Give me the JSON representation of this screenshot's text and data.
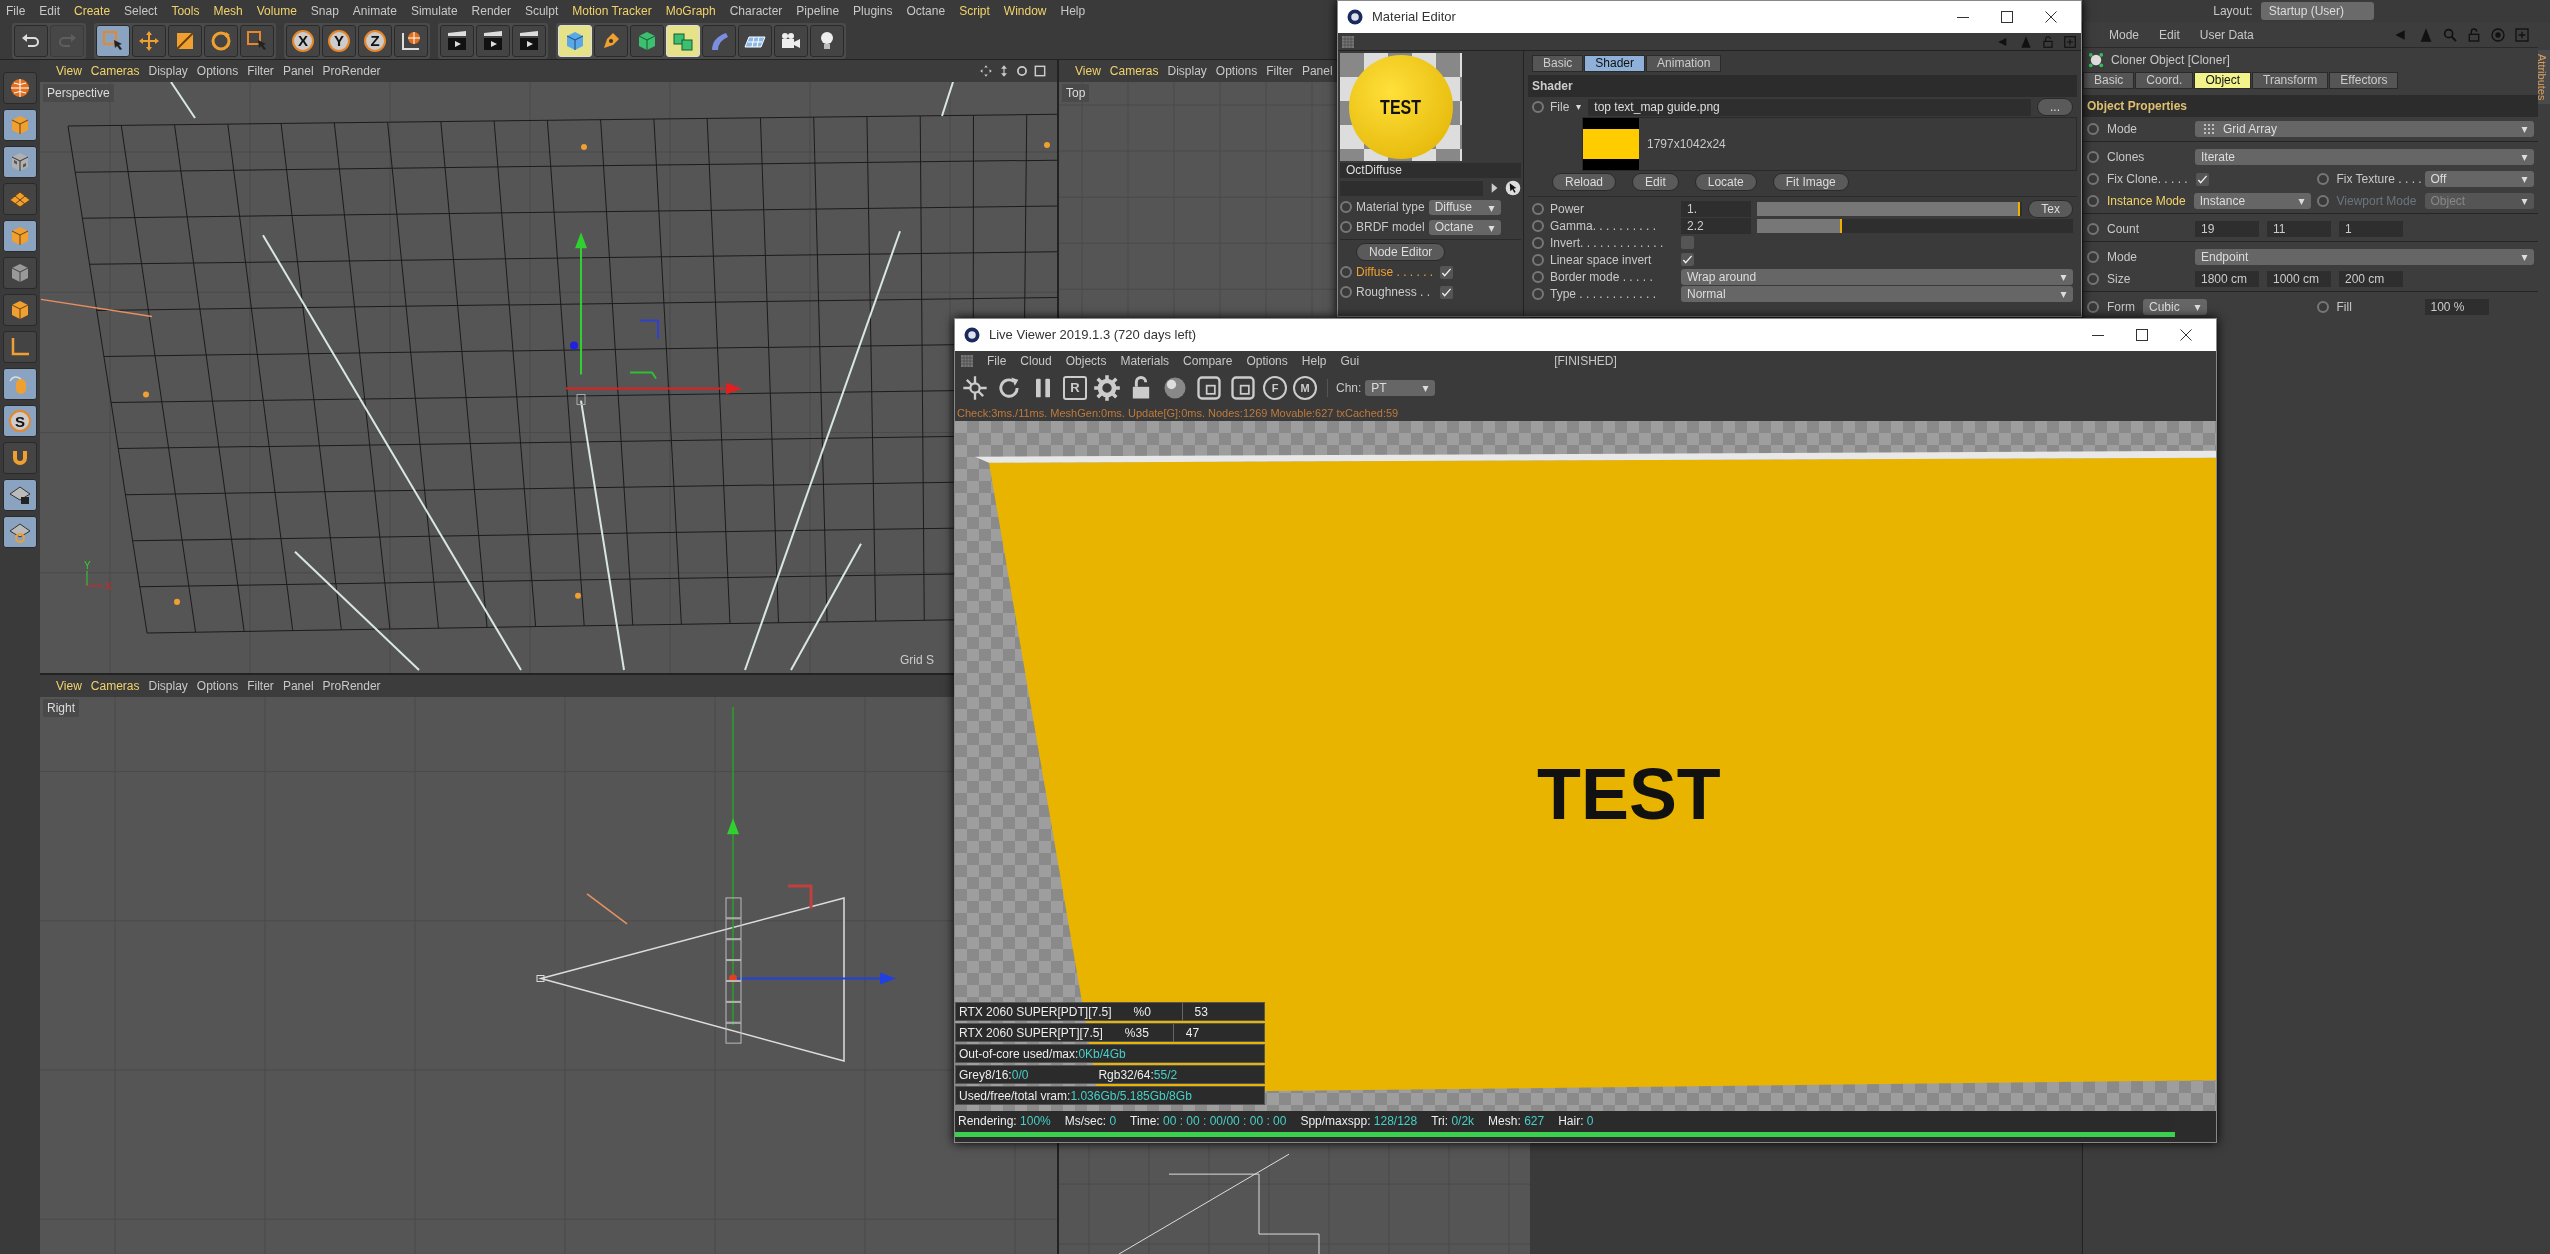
{
  "menu_bar": [
    {
      "label": "File",
      "highlighted": false
    },
    {
      "label": "Edit",
      "highlighted": false
    },
    {
      "label": "Create",
      "highlighted": true
    },
    {
      "label": "Select",
      "highlighted": false
    },
    {
      "label": "Tools",
      "highlighted": true
    },
    {
      "label": "Mesh",
      "highlighted": true
    },
    {
      "label": "Volume",
      "highlighted": true
    },
    {
      "label": "Snap",
      "highlighted": false
    },
    {
      "label": "Animate",
      "highlighted": false
    },
    {
      "label": "Simulate",
      "highlighted": false
    },
    {
      "label": "Render",
      "highlighted": false
    },
    {
      "label": "Sculpt",
      "highlighted": false
    },
    {
      "label": "Motion Tracker",
      "highlighted": true
    },
    {
      "label": "MoGraph",
      "highlighted": true
    },
    {
      "label": "Character",
      "highlighted": false
    },
    {
      "label": "Pipeline",
      "highlighted": false
    },
    {
      "label": "Plugins",
      "highlighted": false
    },
    {
      "label": "Octane",
      "highlighted": false
    },
    {
      "label": "Script",
      "highlighted": true
    },
    {
      "label": "Window",
      "highlighted": true
    },
    {
      "label": "Help",
      "highlighted": false
    }
  ],
  "layout": {
    "label": "Layout:",
    "value": "Startup (User)"
  },
  "toolbar": [
    [
      {
        "kind": "undo",
        "active": false,
        "disabled": false
      },
      {
        "kind": "redo",
        "active": false,
        "disabled": true
      }
    ],
    [
      {
        "kind": "select",
        "active": true
      },
      {
        "kind": "move",
        "active": false
      },
      {
        "kind": "scale",
        "active": false
      },
      {
        "kind": "rotate",
        "active": false
      },
      {
        "kind": "select",
        "active": false
      }
    ],
    [
      {
        "kind": "axis-lock",
        "text": "X",
        "active": false
      },
      {
        "kind": "axis-lock",
        "text": "Y",
        "active": false
      },
      {
        "kind": "axis-lock",
        "text": "Z",
        "active": false
      },
      {
        "kind": "world",
        "active": false
      }
    ],
    [
      {
        "kind": "clapper",
        "active": false
      },
      {
        "kind": "clapper",
        "active": false
      },
      {
        "kind": "clapper",
        "active": false
      }
    ],
    [
      {
        "kind": "cube",
        "active": true
      },
      {
        "kind": "pen",
        "active": false
      },
      {
        "kind": "gcube",
        "active": false
      },
      {
        "kind": "cubes",
        "active": true
      },
      {
        "kind": "bend",
        "active": false
      },
      {
        "kind": "plane",
        "active": false
      },
      {
        "kind": "camera",
        "active": false
      },
      {
        "kind": "bulb",
        "active": false
      }
    ]
  ],
  "side_tools": [
    {
      "kind": "globe",
      "active": false
    },
    {
      "kind": "ocube",
      "active": true
    },
    {
      "kind": "checker",
      "active": true
    },
    {
      "kind": "grid",
      "active": false
    },
    {
      "kind": "ocube",
      "active": true
    },
    {
      "kind": "gcube2",
      "active": false
    },
    {
      "kind": "ocube",
      "active": false
    },
    {
      "kind": "axis",
      "active": false
    },
    {
      "kind": "mouse",
      "active": true
    },
    {
      "kind": "snap",
      "text": "S",
      "active": true
    },
    {
      "kind": "magnet",
      "active": false
    },
    {
      "kind": "gridlock",
      "active": true
    },
    {
      "kind": "gridrot",
      "active": true
    }
  ],
  "viewports": [
    {
      "name": "Perspective",
      "kind": "perspective",
      "grid_label": "Grid S",
      "axis_labels": [
        "Y",
        "X"
      ],
      "menu": [
        {
          "label": "View",
          "highlighted": true
        },
        {
          "label": "Cameras",
          "highlighted": true
        },
        {
          "label": "Display",
          "highlighted": false
        },
        {
          "label": "Options",
          "highlighted": false
        },
        {
          "label": "Filter",
          "highlighted": false
        },
        {
          "label": "Panel",
          "highlighted": false
        },
        {
          "label": "ProRender",
          "highlighted": false
        }
      ]
    },
    {
      "name": "Top",
      "kind": "top",
      "menu": [
        {
          "label": "View",
          "highlighted": true
        },
        {
          "label": "Cameras",
          "highlighted": true
        },
        {
          "label": "Display",
          "highlighted": false
        },
        {
          "label": "Options",
          "highlighted": false
        },
        {
          "label": "Filter",
          "highlighted": false
        },
        {
          "label": "Panel",
          "highlighted": false
        }
      ]
    },
    {
      "name": "Right",
      "kind": "right",
      "menu": [
        {
          "label": "View",
          "highlighted": true
        },
        {
          "label": "Cameras",
          "highlighted": true
        },
        {
          "label": "Display",
          "highlighted": false
        },
        {
          "label": "Options",
          "highlighted": false
        },
        {
          "label": "Filter",
          "highlighted": false
        },
        {
          "label": "Panel",
          "highlighted": false
        },
        {
          "label": "ProRender",
          "highlighted": false
        }
      ]
    },
    {
      "kind": "front"
    }
  ],
  "material_editor": {
    "title": "Material Editor",
    "preview_text": "TEST",
    "material_name": "OctDiffuse",
    "left_params": [
      {
        "label": "Material type",
        "value": "Diffuse"
      },
      {
        "label": "BRDF model",
        "value": "Octane"
      }
    ],
    "node_editor": "Node Editor",
    "channels": [
      {
        "label": "Diffuse . . . . . .",
        "checked": true,
        "selected": true
      },
      {
        "label": "Roughness . .",
        "checked": true,
        "selected": false
      }
    ],
    "tabs": [
      {
        "label": "Basic",
        "selected": false
      },
      {
        "label": "Shader",
        "selected": true
      },
      {
        "label": "Animation",
        "selected": false
      }
    ],
    "section": "Shader",
    "file": {
      "label": "File",
      "value": "top text_map guide.png",
      "browse": "..."
    },
    "image_info": "1797x1042x24",
    "buttons": [
      "Reload",
      "Edit",
      "Locate",
      "Fit Image"
    ],
    "params": [
      {
        "kind": "slider",
        "label": "Power",
        "value": "1.",
        "level": 0.99,
        "button": "Tex"
      },
      {
        "kind": "slider",
        "label": "Gamma. . . . . . . . . .",
        "value": "2.2",
        "level": 0.27
      },
      {
        "kind": "check",
        "label": "Invert. . . . . . . . . . . . .",
        "checked": false
      },
      {
        "kind": "check",
        "label": "Linear space invert",
        "checked": true
      },
      {
        "kind": "dropdown",
        "label": "Border mode . . . . .",
        "value": "Wrap around"
      },
      {
        "kind": "dropdown",
        "label": "Type . . . . . . . . . . . .",
        "value": "Normal"
      }
    ]
  },
  "attributes": {
    "menu": [
      "Mode",
      "Edit",
      "User Data"
    ],
    "title": "Cloner Object [Cloner]",
    "side_tab": "Attributes",
    "tabs": [
      {
        "label": "Basic",
        "selected": false
      },
      {
        "label": "Coord.",
        "selected": false
      },
      {
        "label": "Object",
        "selected": true
      },
      {
        "label": "Transform",
        "selected": false
      },
      {
        "label": "Effectors",
        "selected": false
      }
    ],
    "section": "Object Properties",
    "rows": [
      {
        "divider": false,
        "fields": [
          {
            "kind": "icon-dropdown",
            "label": "Mode",
            "value": "Grid Array",
            "highlighted": false,
            "disabled": false
          }
        ]
      },
      {
        "divider": true,
        "fields": [
          {
            "kind": "dropdown",
            "label": "Clones",
            "value": "Iterate",
            "highlighted": false,
            "disabled": false
          }
        ]
      },
      {
        "divider": false,
        "fields": [
          {
            "kind": "check",
            "label": "Fix Clone. . . . .",
            "checked": true,
            "highlighted": false,
            "disabled": false
          },
          {
            "kind": "dropdown",
            "label": "Fix Texture . . . .",
            "value": "Off",
            "highlighted": false,
            "disabled": false
          }
        ]
      },
      {
        "divider": false,
        "fields": [
          {
            "kind": "dropdown",
            "label": "Instance Mode",
            "value": "Instance",
            "highlighted": true,
            "disabled": false
          },
          {
            "kind": "dropdown",
            "label": "Viewport Mode",
            "value": "Object",
            "highlighted": false,
            "disabled": true
          }
        ]
      },
      {
        "divider": true,
        "fields": [
          {
            "kind": "vector",
            "label": "Count",
            "values": [
              "19",
              "11",
              "1"
            ],
            "highlighted": false,
            "disabled": false
          }
        ]
      },
      {
        "divider": true,
        "fields": [
          {
            "kind": "dropdown",
            "label": "Mode",
            "value": "Endpoint",
            "highlighted": false,
            "disabled": false
          }
        ]
      },
      {
        "divider": false,
        "fields": [
          {
            "kind": "vector",
            "label": "Size",
            "values": [
              "1800 cm",
              "1000 cm",
              "200 cm"
            ],
            "highlighted": false,
            "disabled": false
          }
        ]
      },
      {
        "divider": true,
        "fields": [
          {
            "kind": "short-dropdown",
            "label": "Form",
            "value": "Cubic",
            "highlighted": false,
            "disabled": false
          },
          {
            "kind": "number",
            "label": "Fill",
            "value": "100 %",
            "highlighted": false,
            "disabled": false
          }
        ]
      }
    ]
  },
  "live_viewer": {
    "title": "Live Viewer 2019.1.3 (720 days left)",
    "menu": [
      "File",
      "Cloud",
      "Objects",
      "Materials",
      "Compare",
      "Options",
      "Help",
      "Gui"
    ],
    "status": "[FINISHED]",
    "tools": [
      {
        "kind": "burst"
      },
      {
        "kind": "refresh"
      },
      {
        "kind": "pause"
      },
      {
        "kind": "letter-box",
        "text": "R"
      },
      {
        "kind": "gear"
      },
      {
        "kind": "lock"
      },
      {
        "kind": "sphere"
      },
      {
        "kind": "region"
      },
      {
        "kind": "region"
      },
      {
        "kind": "pin",
        "text": "F"
      },
      {
        "kind": "pin",
        "text": "M"
      }
    ],
    "channel": {
      "label": "Chn:",
      "value": "PT"
    },
    "stats_line": "Check:3ms./11ms. MeshGen:0ms. Update[G]:0ms. Nodes:1269 Movable:627 txCached:59",
    "render_text": "TEST",
    "gpus": [
      {
        "name": "RTX 2060 SUPER[PDT][7.5]",
        "usage": "%0",
        "value": "53"
      },
      {
        "name": "RTX 2060 SUPER[PT][7.5]",
        "usage": "%35",
        "value": "47"
      }
    ],
    "info": [
      [
        {
          "label": "Out-of-core used/max:",
          "value": "0Kb/4Gb"
        }
      ],
      [
        {
          "label": "Grey8/16:",
          "value": "0/0"
        },
        {
          "label": "Rgb32/64:",
          "value": "55/2"
        }
      ],
      [
        {
          "label": "Used/free/total vram:",
          "value": "1.036Gb/5.185Gb/8Gb"
        }
      ]
    ],
    "status_bar": [
      {
        "label": "Rendering:",
        "value": "100%"
      },
      {
        "label": "Ms/sec:",
        "value": "0"
      },
      {
        "label": "Time:",
        "value": "00 : 00 : 00/00 : 00 : 00"
      },
      {
        "label": "Spp/maxspp:",
        "value": "128/128"
      },
      {
        "label": "Tri:",
        "value": "0/2k"
      },
      {
        "label": "Mesh:",
        "value": "627"
      },
      {
        "label": "Hair:",
        "value": "0"
      }
    ],
    "progress": {
      "level": 1.0
    }
  }
}
